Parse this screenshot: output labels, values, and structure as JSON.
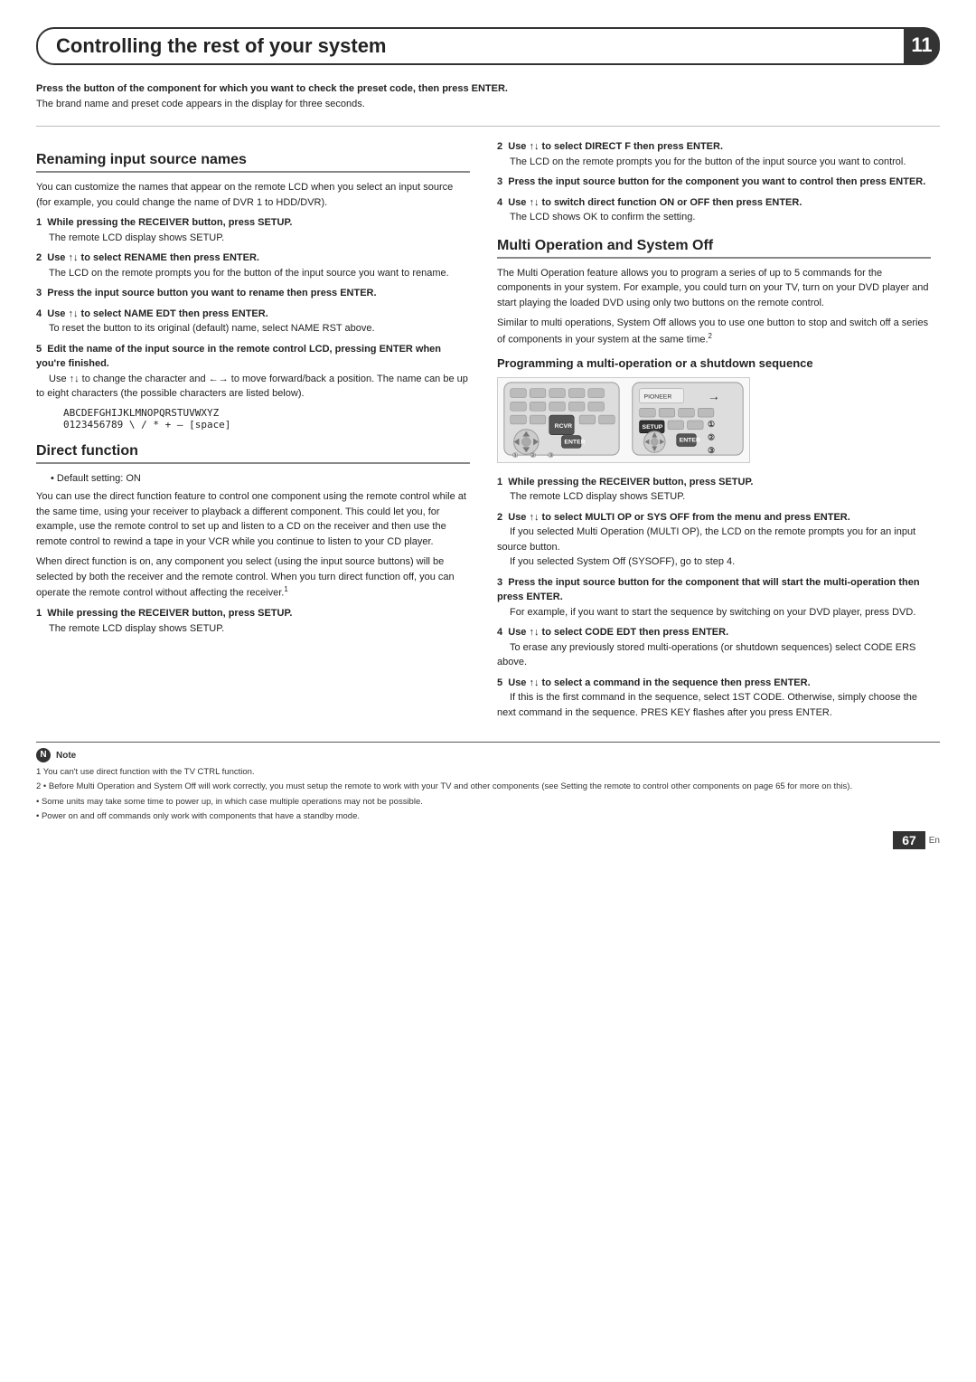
{
  "header": {
    "title": "Controlling the rest of your system",
    "page_number": "11"
  },
  "footer": {
    "page": "67",
    "lang": "En"
  },
  "intro": {
    "step3_bold": "Press the button of the component for which you want to check the preset code, then press ENTER.",
    "step3_text": "The brand name and preset code appears in the display for three seconds."
  },
  "renaming": {
    "title": "Renaming input source names",
    "intro": "You can customize the names that appear on the remote LCD when you select an input source (for example, you could change the name of DVR 1 to HDD/DVR).",
    "step1_bold": "While pressing the RECEIVER button, press SETUP.",
    "step1_text": "The remote LCD display shows SETUP.",
    "step2_bold": "Use ↑↓ to select RENAME then press ENTER.",
    "step2_text": "The LCD on the remote prompts you for the button of the input source you want to rename.",
    "step3_bold": "Press the input source button you want to rename then press ENTER.",
    "step4_bold": "Use ↑↓ to select NAME EDT then press ENTER.",
    "step4_text": "To reset the button to its original (default) name, select NAME RST above.",
    "step5_bold": "Edit the name of the input source in the remote control LCD, pressing ENTER when you're finished.",
    "step5_text": "Use ↑↓ to change the character and ←→ to move forward/back a position. The name can be up to eight characters (the possible characters are listed below).",
    "char_line1": "ABCDEFGHIJKLMNOPQRSTUVWXYZ",
    "char_line2": "0123456789 \\ / * + – [space]"
  },
  "direct_function": {
    "title": "Direct function",
    "bullet1": "Default setting: ON",
    "intro": "You can use the direct function feature to control one component using the remote control while at the same time, using your receiver to playback a different component. This could let you, for example, use the remote control to set up and listen to a CD on the receiver and then use the remote control to rewind a tape in your VCR while you continue to listen to your CD player.",
    "para2": "When direct function is on, any component you select (using the input source buttons) will be selected by both the receiver and the remote control. When you turn direct function off, you can operate the remote control without affecting the receiver.",
    "footnote": "1",
    "step1_bold": "While pressing the RECEIVER button, press SETUP.",
    "step1_text": "The remote LCD display shows SETUP."
  },
  "right_col": {
    "step2_bold": "Use ↑↓ to select DIRECT F then press ENTER.",
    "step2_text": "The LCD on the remote prompts you for the button of the input source you want to control.",
    "step3_bold": "Press the input source button for the component you want to control then press ENTER.",
    "step4_bold": "Use ↑↓ to switch direct function ON or OFF then press ENTER.",
    "step4_text": "The LCD shows OK to confirm the setting."
  },
  "multi_op": {
    "title": "Multi Operation and System Off",
    "intro": "The Multi Operation feature allows you to program a series of up to 5 commands for the components in your system. For example, you could turn on your TV, turn on your DVD player and start playing the loaded DVD using only two buttons on the remote control.",
    "para2": "Similar to multi operations, System Off allows you to use one button to stop and switch off a series of components in your system at the same time.",
    "footnote": "2",
    "sub_title": "Programming a multi-operation or a shutdown sequence",
    "step1_bold": "While pressing the RECEIVER button, press SETUP.",
    "step1_text": "The remote LCD display shows SETUP.",
    "step2_bold": "Use ↑↓ to select MULTI OP or SYS OFF from the menu and press ENTER.",
    "step2_text1": "If you selected Multi Operation (MULTI OP), the LCD on the remote prompts you for an input source button.",
    "step2_text2": "If you selected System Off (SYSOFF), go to step 4.",
    "step3_bold": "Press the input source button for the component that will start the multi-operation then press ENTER.",
    "step3_text": "For example, if you want to start the sequence by switching on your DVD player, press DVD.",
    "step4_bold": "Use ↑↓ to select CODE EDT then press ENTER.",
    "step4_text": "To erase any previously stored multi-operations (or shutdown sequences) select CODE ERS above.",
    "step5_bold": "Use ↑↓ to select a command in the sequence then press ENTER.",
    "step5_text": "If this is the first command in the sequence, select 1ST CODE. Otherwise, simply choose the next command in the sequence. PRES KEY flashes after you press ENTER."
  },
  "notes": {
    "label": "Note",
    "note1": "1  You can't use direct function with the TV CTRL function.",
    "note2": "2  • Before Multi Operation and System Off will work correctly, you must setup the remote to work with your TV and other components (see Setting the remote to control other components on page 65 for more on this).",
    "note3": "  • Some units may take some time to power up, in which case multiple operations may not be possible.",
    "note4": "  • Power on and off commands only work with components that have a standby mode."
  }
}
